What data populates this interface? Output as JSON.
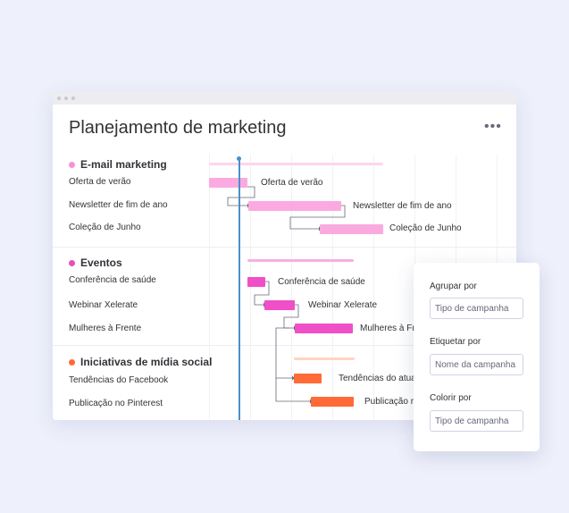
{
  "board": {
    "title": "Planejamento de marketing",
    "more_icon": "•••"
  },
  "groups": [
    {
      "name": "E-mail marketing",
      "color": "#fbaae0",
      "dot_color": "#f792d9",
      "items": [
        {
          "label": "Oferta de verão",
          "bar_label": "Oferta de verão"
        },
        {
          "label": "Newsletter de fim de ano",
          "bar_label": "Newsletter de fim de ano"
        },
        {
          "label": "Coleção de Junho",
          "bar_label": "Coleção de Junho"
        }
      ]
    },
    {
      "name": "Eventos",
      "color": "#ef4fc7",
      "dot_color": "#e64fbf",
      "items": [
        {
          "label": "Conferência de saúde",
          "bar_label": "Conferência de saúde"
        },
        {
          "label": "Webinar Xelerate",
          "bar_label": "Webinar Xelerate"
        },
        {
          "label": "Mulheres à Frente",
          "bar_label": "Mulheres à Fr"
        }
      ]
    },
    {
      "name": "Iniciativas de mídia social",
      "color": "#ff6a36",
      "dot_color": "#ff6a36",
      "items": [
        {
          "label": "Tendências do Facebook",
          "bar_label": "Tendências do atua"
        },
        {
          "label": "Publicação no Pinterest",
          "bar_label": "Publicação r"
        }
      ]
    }
  ],
  "settings_panel": {
    "group_by": {
      "label": "Agrupar por",
      "value": "Tipo de campanha"
    },
    "label_by": {
      "label": "Etiquetar por",
      "value": "Nome da campanha"
    },
    "color_by": {
      "label": "Colorir por",
      "value": "Tipo de campanha"
    }
  }
}
